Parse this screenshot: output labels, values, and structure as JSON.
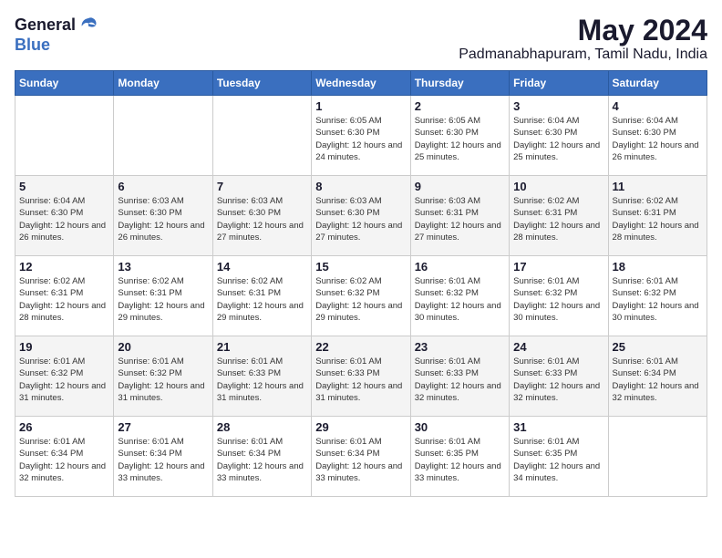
{
  "header": {
    "logo_general": "General",
    "logo_blue": "Blue",
    "month_year": "May 2024",
    "location": "Padmanabhapuram, Tamil Nadu, India"
  },
  "weekdays": [
    "Sunday",
    "Monday",
    "Tuesday",
    "Wednesday",
    "Thursday",
    "Friday",
    "Saturday"
  ],
  "weeks": [
    [
      null,
      null,
      null,
      {
        "day": "1",
        "sunrise": "6:05 AM",
        "sunset": "6:30 PM",
        "daylight": "12 hours and 24 minutes."
      },
      {
        "day": "2",
        "sunrise": "6:05 AM",
        "sunset": "6:30 PM",
        "daylight": "12 hours and 25 minutes."
      },
      {
        "day": "3",
        "sunrise": "6:04 AM",
        "sunset": "6:30 PM",
        "daylight": "12 hours and 25 minutes."
      },
      {
        "day": "4",
        "sunrise": "6:04 AM",
        "sunset": "6:30 PM",
        "daylight": "12 hours and 26 minutes."
      }
    ],
    [
      {
        "day": "5",
        "sunrise": "6:04 AM",
        "sunset": "6:30 PM",
        "daylight": "12 hours and 26 minutes."
      },
      {
        "day": "6",
        "sunrise": "6:03 AM",
        "sunset": "6:30 PM",
        "daylight": "12 hours and 26 minutes."
      },
      {
        "day": "7",
        "sunrise": "6:03 AM",
        "sunset": "6:30 PM",
        "daylight": "12 hours and 27 minutes."
      },
      {
        "day": "8",
        "sunrise": "6:03 AM",
        "sunset": "6:30 PM",
        "daylight": "12 hours and 27 minutes."
      },
      {
        "day": "9",
        "sunrise": "6:03 AM",
        "sunset": "6:31 PM",
        "daylight": "12 hours and 27 minutes."
      },
      {
        "day": "10",
        "sunrise": "6:02 AM",
        "sunset": "6:31 PM",
        "daylight": "12 hours and 28 minutes."
      },
      {
        "day": "11",
        "sunrise": "6:02 AM",
        "sunset": "6:31 PM",
        "daylight": "12 hours and 28 minutes."
      }
    ],
    [
      {
        "day": "12",
        "sunrise": "6:02 AM",
        "sunset": "6:31 PM",
        "daylight": "12 hours and 28 minutes."
      },
      {
        "day": "13",
        "sunrise": "6:02 AM",
        "sunset": "6:31 PM",
        "daylight": "12 hours and 29 minutes."
      },
      {
        "day": "14",
        "sunrise": "6:02 AM",
        "sunset": "6:31 PM",
        "daylight": "12 hours and 29 minutes."
      },
      {
        "day": "15",
        "sunrise": "6:02 AM",
        "sunset": "6:32 PM",
        "daylight": "12 hours and 29 minutes."
      },
      {
        "day": "16",
        "sunrise": "6:01 AM",
        "sunset": "6:32 PM",
        "daylight": "12 hours and 30 minutes."
      },
      {
        "day": "17",
        "sunrise": "6:01 AM",
        "sunset": "6:32 PM",
        "daylight": "12 hours and 30 minutes."
      },
      {
        "day": "18",
        "sunrise": "6:01 AM",
        "sunset": "6:32 PM",
        "daylight": "12 hours and 30 minutes."
      }
    ],
    [
      {
        "day": "19",
        "sunrise": "6:01 AM",
        "sunset": "6:32 PM",
        "daylight": "12 hours and 31 minutes."
      },
      {
        "day": "20",
        "sunrise": "6:01 AM",
        "sunset": "6:32 PM",
        "daylight": "12 hours and 31 minutes."
      },
      {
        "day": "21",
        "sunrise": "6:01 AM",
        "sunset": "6:33 PM",
        "daylight": "12 hours and 31 minutes."
      },
      {
        "day": "22",
        "sunrise": "6:01 AM",
        "sunset": "6:33 PM",
        "daylight": "12 hours and 31 minutes."
      },
      {
        "day": "23",
        "sunrise": "6:01 AM",
        "sunset": "6:33 PM",
        "daylight": "12 hours and 32 minutes."
      },
      {
        "day": "24",
        "sunrise": "6:01 AM",
        "sunset": "6:33 PM",
        "daylight": "12 hours and 32 minutes."
      },
      {
        "day": "25",
        "sunrise": "6:01 AM",
        "sunset": "6:34 PM",
        "daylight": "12 hours and 32 minutes."
      }
    ],
    [
      {
        "day": "26",
        "sunrise": "6:01 AM",
        "sunset": "6:34 PM",
        "daylight": "12 hours and 32 minutes."
      },
      {
        "day": "27",
        "sunrise": "6:01 AM",
        "sunset": "6:34 PM",
        "daylight": "12 hours and 33 minutes."
      },
      {
        "day": "28",
        "sunrise": "6:01 AM",
        "sunset": "6:34 PM",
        "daylight": "12 hours and 33 minutes."
      },
      {
        "day": "29",
        "sunrise": "6:01 AM",
        "sunset": "6:34 PM",
        "daylight": "12 hours and 33 minutes."
      },
      {
        "day": "30",
        "sunrise": "6:01 AM",
        "sunset": "6:35 PM",
        "daylight": "12 hours and 33 minutes."
      },
      {
        "day": "31",
        "sunrise": "6:01 AM",
        "sunset": "6:35 PM",
        "daylight": "12 hours and 34 minutes."
      },
      null
    ]
  ]
}
